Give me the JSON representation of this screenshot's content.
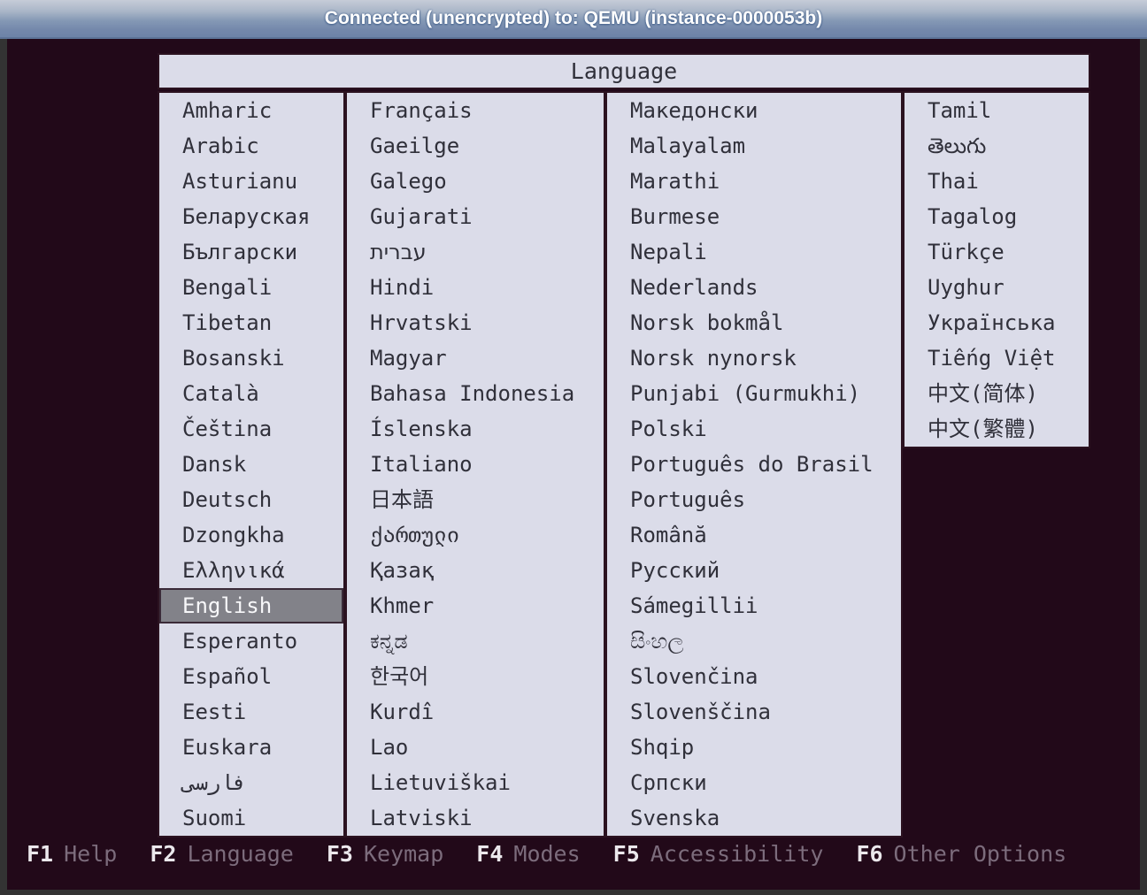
{
  "status_bar": {
    "text": "Connected (unencrypted) to: QEMU (instance-0000053b)"
  },
  "dialog": {
    "title": "Language"
  },
  "language_menu": {
    "selected": "English",
    "columns": [
      {
        "items": [
          "Amharic",
          "Arabic",
          "Asturianu",
          "Беларуская",
          "Български",
          "Bengali",
          "Tibetan",
          "Bosanski",
          "Català",
          "Čeština",
          "Dansk",
          "Deutsch",
          "Dzongkha",
          "Ελληνικά",
          "English",
          "Esperanto",
          "Español",
          "Eesti",
          "Euskara",
          "فارسی",
          "Suomi"
        ]
      },
      {
        "items": [
          "Français",
          "Gaeilge",
          "Galego",
          "Gujarati",
          "עברית",
          "Hindi",
          "Hrvatski",
          "Magyar",
          "Bahasa Indonesia",
          "Íslenska",
          "Italiano",
          "日本語",
          "ქართული",
          "Қазақ",
          "Khmer",
          "ಕನ್ನಡ",
          "한국어",
          "Kurdî",
          "Lao",
          "Lietuviškai",
          "Latviski"
        ]
      },
      {
        "items": [
          "Македонски",
          "Malayalam",
          "Marathi",
          "Burmese",
          "Nepali",
          "Nederlands",
          "Norsk bokmål",
          "Norsk nynorsk",
          "Punjabi (Gurmukhi)",
          "Polski",
          "Português do Brasil",
          "Português",
          "Română",
          "Русский",
          "Sámegillii",
          "සිංහල",
          "Slovenčina",
          "Slovenščina",
          "Shqip",
          "Српски",
          "Svenska"
        ]
      },
      {
        "items": [
          "Tamil",
          "తెలుగు",
          "Thai",
          "Tagalog",
          "Türkçe",
          "Uyghur",
          "Українська",
          "Tiếng Việt",
          "中文(简体)",
          "中文(繁體)"
        ]
      }
    ]
  },
  "function_keys": [
    {
      "key": "F1",
      "label": "Help"
    },
    {
      "key": "F2",
      "label": "Language"
    },
    {
      "key": "F3",
      "label": "Keymap"
    },
    {
      "key": "F4",
      "label": "Modes"
    },
    {
      "key": "F5",
      "label": "Accessibility"
    },
    {
      "key": "F6",
      "label": "Other Options"
    }
  ],
  "colors": {
    "page_background": "#333333",
    "vm_background": "#220919",
    "panel_background": "#dbdce9",
    "panel_border": "#2b1220",
    "panel_text": "#30303a",
    "highlight_background": "#828289",
    "highlight_border": "#3a2a38",
    "highlight_text": "#f7f7f9",
    "status_bar_gradient_top": "#c6ccd8",
    "status_bar_gradient_bottom": "#6d83a7",
    "status_bar_text": "#ffffff",
    "fkey_key_text": "#ebe8ec",
    "fkey_label_text": "#7c6c7c"
  }
}
